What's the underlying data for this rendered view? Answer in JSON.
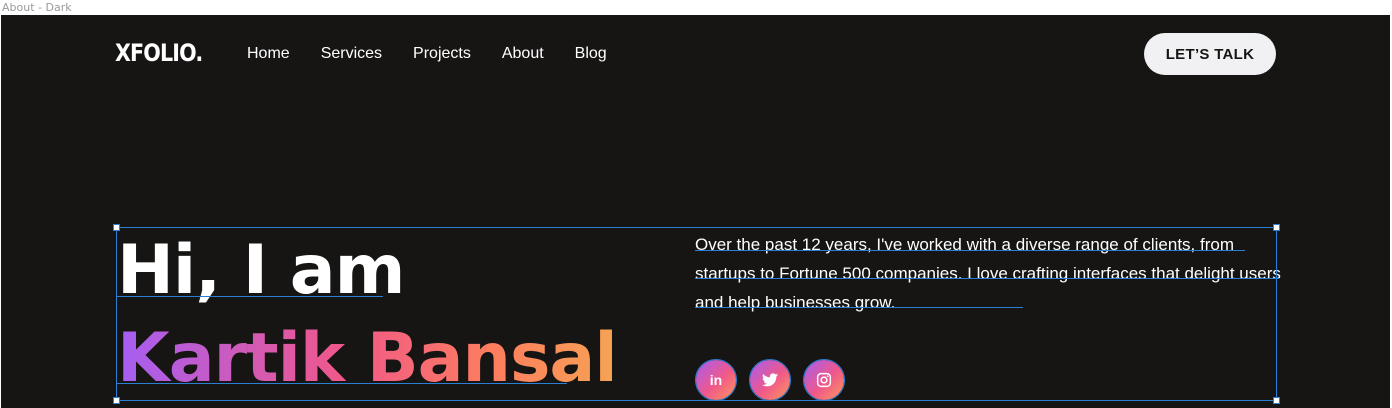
{
  "frame": {
    "label": "About - Dark"
  },
  "header": {
    "logo": "XFOLIO.",
    "nav": [
      {
        "label": "Home"
      },
      {
        "label": "Services"
      },
      {
        "label": "Projects"
      },
      {
        "label": "About"
      },
      {
        "label": "Blog"
      }
    ],
    "cta_label": "LET’S TALK"
  },
  "hero": {
    "greeting": "Hi, I am",
    "name": "Kartik Bansal",
    "description": "Over the past 12 years, I've worked with a diverse range of clients, from startups to Fortune 500 companies. I love crafting interfaces that delight users and help businesses grow."
  },
  "social": [
    {
      "icon": "linkedin-icon",
      "glyph": "in"
    },
    {
      "icon": "twitter-icon",
      "glyph": ""
    },
    {
      "icon": "instagram-icon",
      "glyph": ""
    }
  ],
  "colors": {
    "background": "#161514",
    "text": "#ffffff",
    "cta_bg": "#f1f1f3",
    "gradient": [
      "#a55ef4",
      "#f0588a",
      "#fd7d5e",
      "#f6a454"
    ],
    "selection": "#2a7fd4"
  }
}
